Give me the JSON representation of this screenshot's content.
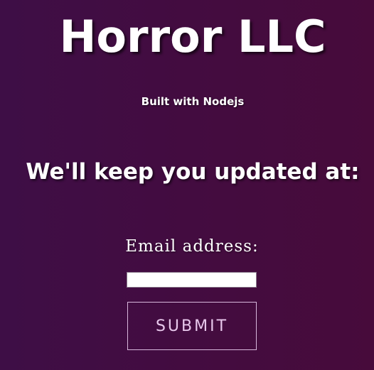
{
  "header": {
    "title": "Horror LLC",
    "subtitle": "Built with Nodejs"
  },
  "main": {
    "heading": "We'll keep you updated at:"
  },
  "form": {
    "email_label": "Email address:",
    "email_value": "",
    "submit_label": "SUBMIT"
  }
}
